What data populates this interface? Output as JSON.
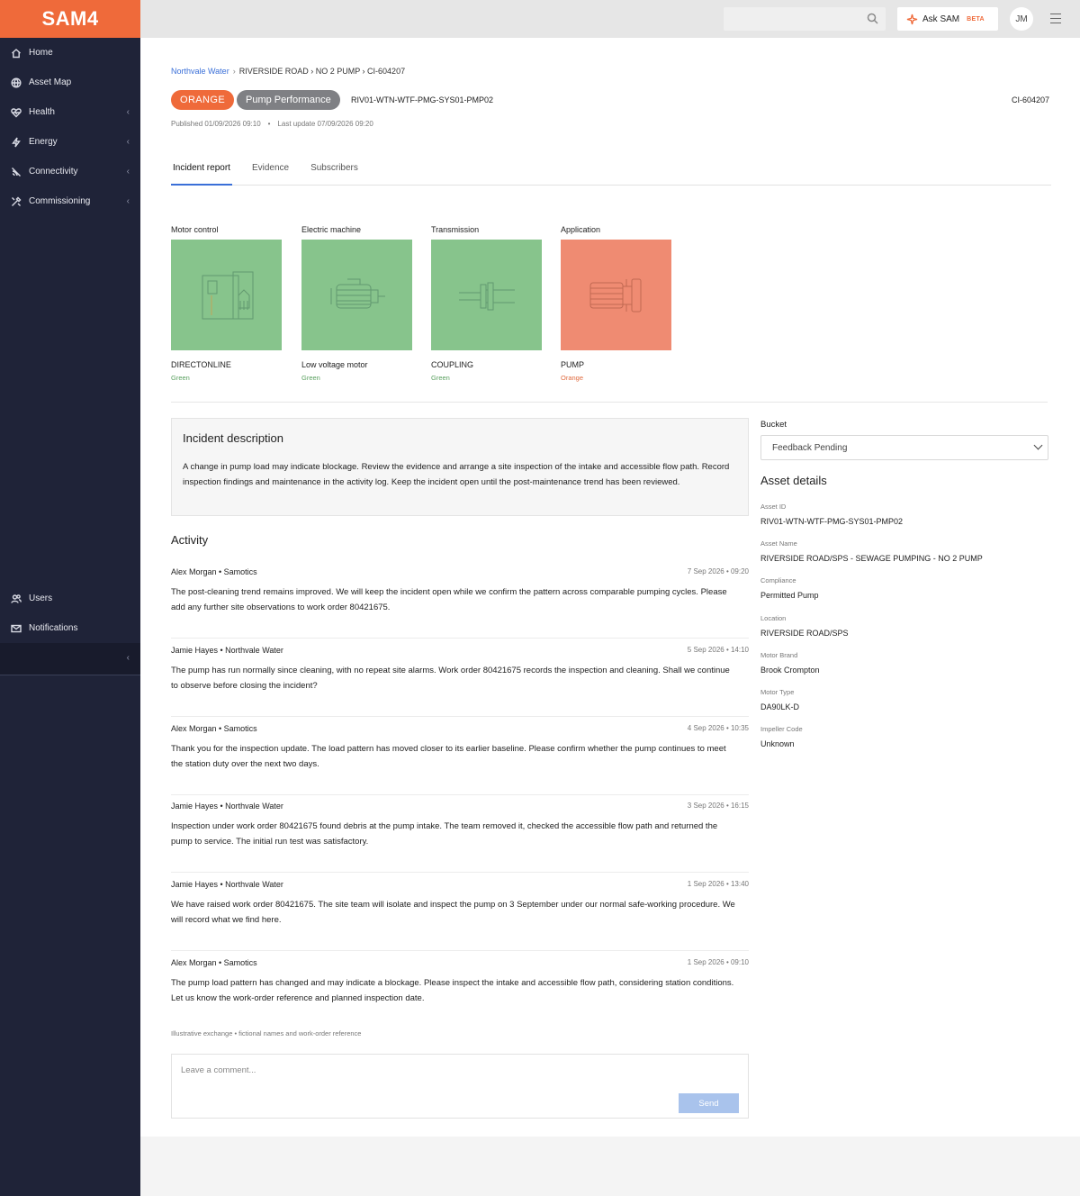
{
  "app": {
    "logo": "SAM4"
  },
  "sidebar": {
    "items": [
      {
        "label": "Home",
        "icon": "home-icon",
        "chevron": false
      },
      {
        "label": "Asset Map",
        "icon": "globe-icon",
        "chevron": false
      },
      {
        "label": "Health",
        "icon": "heart-icon",
        "chevron": true
      },
      {
        "label": "Energy",
        "icon": "bolt-icon",
        "chevron": true
      },
      {
        "label": "Connectivity",
        "icon": "signal-icon",
        "chevron": true
      },
      {
        "label": "Commissioning",
        "icon": "tools-icon",
        "chevron": true
      }
    ],
    "bottom_items": [
      {
        "label": "Users",
        "icon": "users-icon"
      },
      {
        "label": "Notifications",
        "icon": "mail-icon"
      }
    ],
    "chevron": "‹"
  },
  "topbar": {
    "search_placeholder": "",
    "ask_label": "Ask SAM",
    "ask_badge": "BETA",
    "avatar_initials": "JM"
  },
  "header": {
    "breadcrumb": {
      "root": "Northvale Water",
      "rest": "RIVERSIDE ROAD › NO 2 PUMP › CI-604207",
      "sep": "›"
    },
    "severity_badge": "ORANGE",
    "category_badge": "Pump Performance",
    "asset_code": "RIV01-WTN-WTF-PMG-SYS01-PMP02",
    "incident_id": "CI-604207",
    "published": "Published 01/09/2026 09:10",
    "last_update": "Last update 07/09/2026 09:20",
    "dot": "•",
    "tabs": [
      "Incident report",
      "Evidence",
      "Subscribers"
    ]
  },
  "systems": [
    {
      "title": "Motor control",
      "name": "DIRECTONLINE",
      "status": "Green",
      "color": "#87c48c",
      "status_color": "#5aa05f"
    },
    {
      "title": "Electric machine",
      "name": "Low voltage motor",
      "status": "Green",
      "color": "#87c48c",
      "status_color": "#5aa05f"
    },
    {
      "title": "Transmission",
      "name": "COUPLING",
      "status": "Green",
      "color": "#87c48c",
      "status_color": "#5aa05f"
    },
    {
      "title": "Application",
      "name": "PUMP",
      "status": "Orange",
      "color": "#ef8b72",
      "status_color": "#e06a3e"
    }
  ],
  "incident": {
    "title": "Incident description",
    "text": "A change in pump load may indicate blockage. Review the evidence and arrange a site inspection of the intake and accessible flow path. Record inspection findings and maintenance in the activity log. Keep the incident open until the post-maintenance trend has been reviewed."
  },
  "activity": {
    "title": "Activity",
    "entries": [
      {
        "who": "Alex Morgan • Samotics",
        "when": "7 Sep 2026 • 09:20",
        "msg": "The post-cleaning trend remains improved. We will keep the incident open while we confirm the pattern across comparable pumping cycles. Please add any further site observations to work order 80421675."
      },
      {
        "who": "Jamie Hayes • Northvale Water",
        "when": "5 Sep 2026 • 14:10",
        "msg": "The pump has run normally since cleaning, with no repeat site alarms. Work order 80421675 records the inspection and cleaning. Shall we continue to observe before closing the incident?"
      },
      {
        "who": "Alex Morgan • Samotics",
        "when": "4 Sep 2026 • 10:35",
        "msg": "Thank you for the inspection update. The load pattern has moved closer to its earlier baseline. Please confirm whether the pump continues to meet the station duty over the next two days."
      },
      {
        "who": "Jamie Hayes • Northvale Water",
        "when": "3 Sep 2026 • 16:15",
        "msg": "Inspection under work order 80421675 found debris at the pump intake. The team removed it, checked the accessible flow path and returned the pump to service. The initial run test was satisfactory."
      },
      {
        "who": "Jamie Hayes • Northvale Water",
        "when": "1 Sep 2026 • 13:40",
        "msg": "We have raised work order 80421675. The site team will isolate and inspect the pump on 3 September under our normal safe-working procedure. We will record what we find here."
      },
      {
        "who": "Alex Morgan • Samotics",
        "when": "1 Sep 2026 • 09:10",
        "msg": "The pump load pattern has changed and may indicate a blockage. Please inspect the intake and accessible flow path, considering station conditions. Let us know the work-order reference and planned inspection date."
      }
    ],
    "note": "Illustrative exchange • fictional names and work-order reference",
    "comment_placeholder": "Leave a comment...",
    "send_label": "Send"
  },
  "bucket": {
    "label": "Bucket",
    "value": "Feedback Pending"
  },
  "asset_details": {
    "title": "Asset details",
    "fields": [
      {
        "k": "Asset ID",
        "v": "RIV01-WTN-WTF-PMG-SYS01-PMP02"
      },
      {
        "k": "Asset Name",
        "v": "RIVERSIDE ROAD/SPS - SEWAGE PUMPING - NO 2 PUMP"
      },
      {
        "k": "Compliance",
        "v": "Permitted Pump"
      },
      {
        "k": "Location",
        "v": "RIVERSIDE ROAD/SPS"
      },
      {
        "k": "Motor Brand",
        "v": "Brook Crompton"
      },
      {
        "k": "Motor Type",
        "v": "DA90LK-D"
      },
      {
        "k": "Impeller Code",
        "v": "Unknown"
      }
    ]
  }
}
